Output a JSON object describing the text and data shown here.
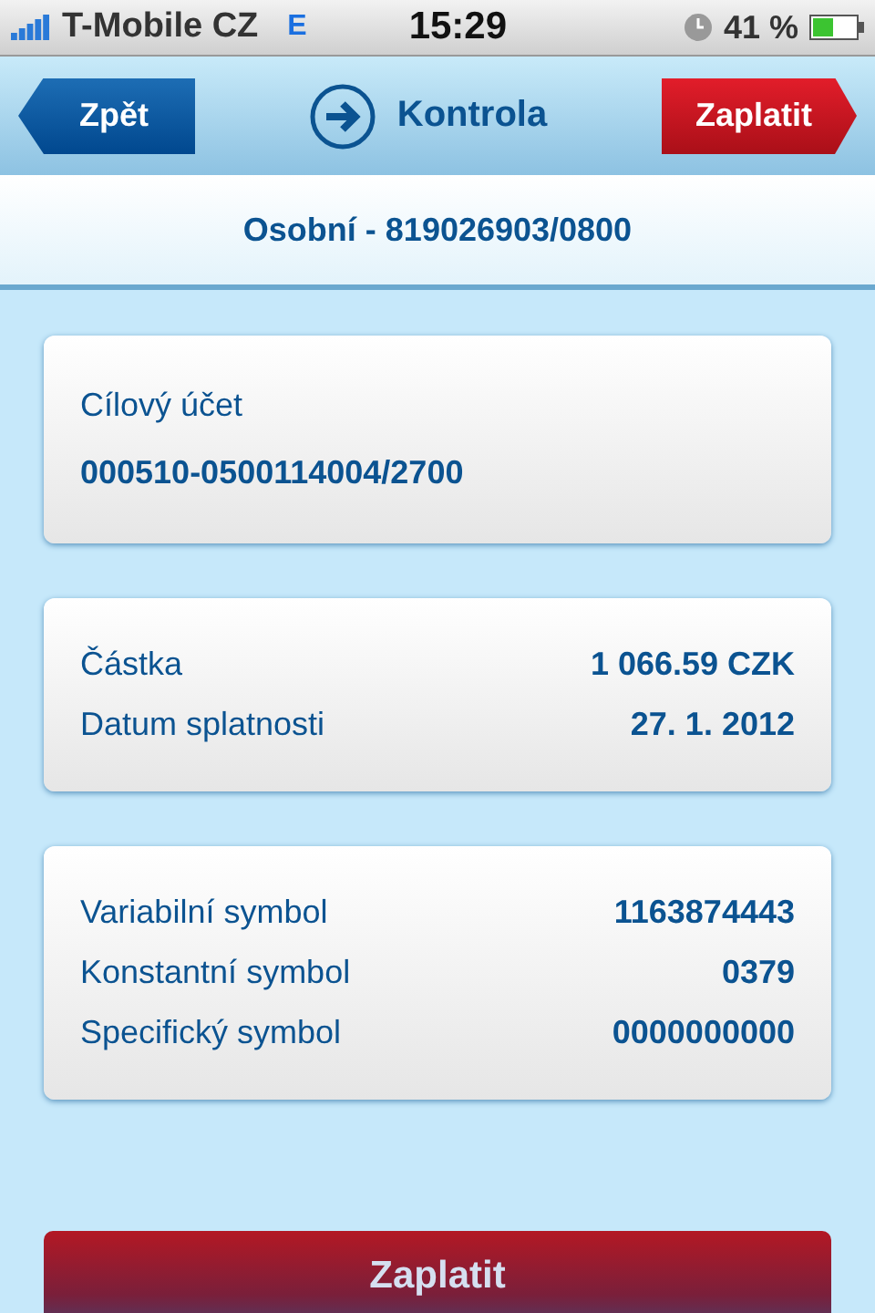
{
  "status_bar": {
    "carrier": "T-Mobile CZ",
    "network": "E",
    "time": "15:29",
    "battery": "41 %"
  },
  "nav": {
    "back": "Zpět",
    "title": "Kontrola",
    "action": "Zaplatit"
  },
  "account": "Osobní - 819026903/0800",
  "cards": [
    {
      "kind": "stacked",
      "rows": [
        {
          "label": "Cílový účet",
          "value": "000510-0500114004/2700"
        }
      ]
    },
    {
      "kind": "pairs",
      "rows": [
        {
          "label": "Částka",
          "value": "1 066.59 CZK"
        },
        {
          "label": "Datum splatnosti",
          "value": "27. 1. 2012"
        }
      ]
    },
    {
      "kind": "pairs",
      "rows": [
        {
          "label": "Variabilní symbol",
          "value": "1163874443"
        },
        {
          "label": "Konstantní symbol",
          "value": "0379"
        },
        {
          "label": "Specifický symbol",
          "value": "0000000000"
        }
      ]
    }
  ],
  "submit": "Zaplatit"
}
